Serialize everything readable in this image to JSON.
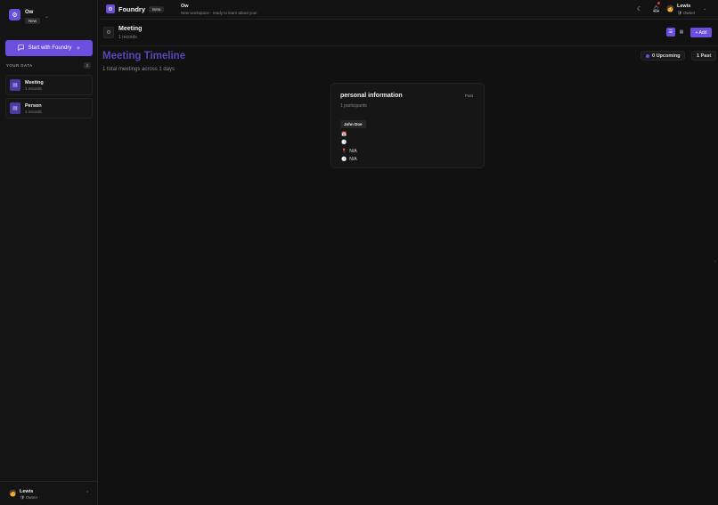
{
  "workspace": {
    "avatar_glyph": "⚙",
    "name": "Ow",
    "badge": "New"
  },
  "sidebar": {
    "start_button_label": "Start with Foundry",
    "section_label": "YOUR DATA",
    "section_count": "2",
    "items": [
      {
        "title": "Meeting",
        "subtitle": "1 records"
      },
      {
        "title": "Person",
        "subtitle": "1 records"
      }
    ],
    "user": {
      "name": "Lewis",
      "role": "Owner"
    }
  },
  "topbar": {
    "app_name": "Foundry",
    "beta_label": "Beta",
    "workspace_title": "Ow",
    "workspace_desc": "New workspace - ready to learn about you!",
    "user": {
      "name": "Lewis",
      "role": "Owner"
    }
  },
  "entity": {
    "title": "Meeting",
    "count": "1 records",
    "add_label": "+ Add"
  },
  "main": {
    "heading": "Meeting Timeline",
    "subheading": "1 total meetings across 1 days",
    "upcoming_label": "0 Upcoming",
    "past_label": "1 Past"
  },
  "meeting": {
    "title": "personal information",
    "status": "Past",
    "participants_label": "1 participants",
    "participant": "John Doe",
    "location": "N/A",
    "duration": "N/A"
  },
  "colors": {
    "accent": "#6d4fe0",
    "background": "#111111",
    "heading": "#5a46b8"
  }
}
